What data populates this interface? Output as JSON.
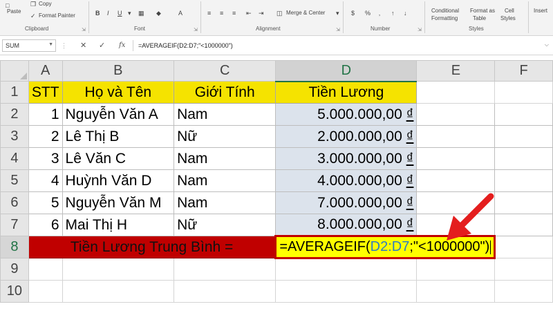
{
  "ribbon": {
    "clipboard": {
      "paste": "Paste",
      "copy": "Copy",
      "format_painter": "Format Painter",
      "label": "Clipboard"
    },
    "font": {
      "label": "Font"
    },
    "alignment": {
      "merge_center": "Merge & Center",
      "label": "Alignment"
    },
    "number": {
      "label": "Number"
    },
    "styles": {
      "conditional": "Conditional",
      "formatting": "Formatting",
      "format_as": "Format as",
      "table": "Table",
      "cell": "Cell",
      "cell_styles": "Styles",
      "label": "Styles"
    },
    "cells": {
      "insert": "Insert"
    }
  },
  "formula_bar": {
    "name_box": "SUM",
    "fx": "fx",
    "formula": "=AVERAGEIF(D2:D7;\"<1000000\")"
  },
  "columns": [
    "A",
    "B",
    "C",
    "D",
    "E",
    "F"
  ],
  "selected_column": "D",
  "rows": [
    "1",
    "2",
    "3",
    "4",
    "5",
    "6",
    "7",
    "8",
    "9",
    "10"
  ],
  "header": {
    "stt": "STT",
    "name": "Họ và Tên",
    "gender": "Giới Tính",
    "salary": "Tiền Lương"
  },
  "data": [
    {
      "stt": "1",
      "name": "Nguyễn Văn A",
      "gender": "Nam",
      "amount": "5.000.000,00",
      "currency": "₫"
    },
    {
      "stt": "2",
      "name": "Lê Thị B",
      "gender": "Nữ",
      "amount": "2.000.000,00",
      "currency": "₫"
    },
    {
      "stt": "3",
      "name": "Lê Văn C",
      "gender": "Nam",
      "amount": "3.000.000,00",
      "currency": "₫"
    },
    {
      "stt": "4",
      "name": "Huỳnh Văn D",
      "gender": "Nam",
      "amount": "4.000.000,00",
      "currency": "₫"
    },
    {
      "stt": "5",
      "name": "Nguyễn Văn M",
      "gender": "Nam",
      "amount": "7.000.000,00",
      "currency": "₫"
    },
    {
      "stt": "6",
      "name": "Mai Thị H",
      "gender": "Nữ",
      "amount": "8.000.000,00",
      "currency": "₫"
    }
  ],
  "average_row": {
    "label": "Tiền Lương Trung Bình =",
    "formula_prefix": "=AVERAGEIF(",
    "formula_ref": "D2:D7",
    "formula_suffix": ";\"<1000000\")"
  },
  "colors": {
    "header_fill": "#f5e300",
    "average_fill": "#c00000",
    "edit_fill": "#ffff00",
    "arrow": "#e41e1e",
    "selection": "#217346"
  }
}
